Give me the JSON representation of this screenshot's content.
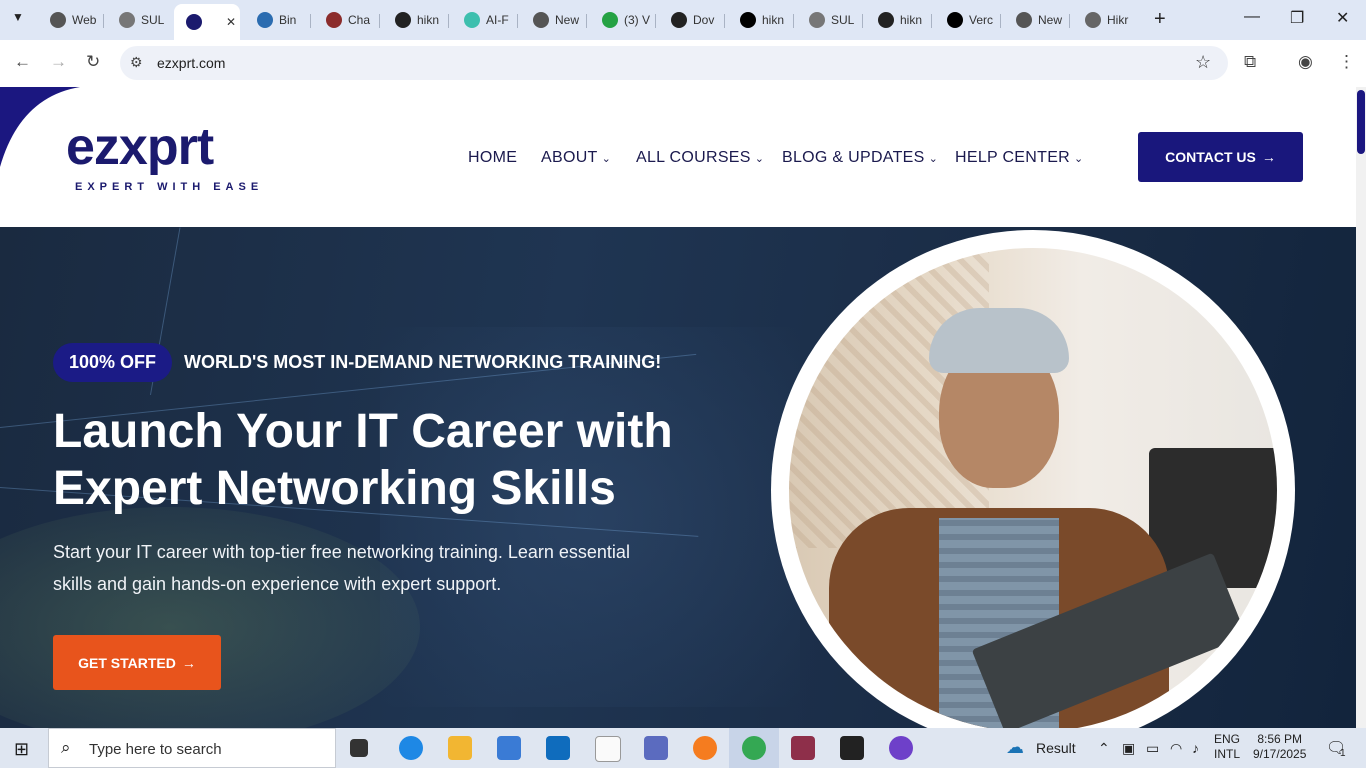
{
  "browser": {
    "tabs": [
      {
        "title": "Web",
        "color": "#555555"
      },
      {
        "title": "SUL",
        "color": "#777777"
      },
      {
        "title": "",
        "color": "#1b1a6e"
      },
      {
        "title": "Bin",
        "color": "#2b6cb0"
      },
      {
        "title": "Cha",
        "color": "#8b2c2c"
      },
      {
        "title": "hikn",
        "color": "#222222"
      },
      {
        "title": "AI-F",
        "color": "#3dbfae"
      },
      {
        "title": "New",
        "color": "#555555"
      },
      {
        "title": "(3) V",
        "color": "#25a244"
      },
      {
        "title": "Dov",
        "color": "#222222"
      },
      {
        "title": "hikn",
        "color": "#000000"
      },
      {
        "title": "SUL",
        "color": "#777777"
      },
      {
        "title": "hikn",
        "color": "#222222"
      },
      {
        "title": "Verc",
        "color": "#000000"
      },
      {
        "title": "New",
        "color": "#555555"
      },
      {
        "title": "Hikr",
        "color": "#666666"
      }
    ],
    "new_tab_icon": "+",
    "url": "ezxprt.com"
  },
  "site": {
    "logo": "ezxprt",
    "tagline": "EXPERT WITH EASE",
    "nav": [
      {
        "label": "HOME",
        "dropdown": false
      },
      {
        "label": "ABOUT",
        "dropdown": true
      },
      {
        "label": "ALL COURSES",
        "dropdown": true
      },
      {
        "label": "BLOG & UPDATES",
        "dropdown": true
      },
      {
        "label": "HELP CENTER",
        "dropdown": true
      }
    ],
    "contact_label": "CONTACT US",
    "accent": "#19177c",
    "cta_color": "#e8541c"
  },
  "hero": {
    "badge": "100% OFF",
    "badge_text": "WORLD'S MOST IN-DEMAND NETWORKING TRAINING!",
    "title_line1": "Launch Your IT Career with",
    "title_line2": "Expert Networking Skills",
    "subtitle": "Start your IT career with top-tier free networking training. Learn essential skills and gain hands-on experience with expert support.",
    "cta_label": "GET STARTED"
  },
  "taskbar": {
    "search_placeholder": "Type here to search",
    "weather": "Result",
    "lang_line1": "ENG",
    "lang_line2": "INTL",
    "time": "8:56 PM",
    "date": "9/17/2025",
    "notifications": "1"
  }
}
